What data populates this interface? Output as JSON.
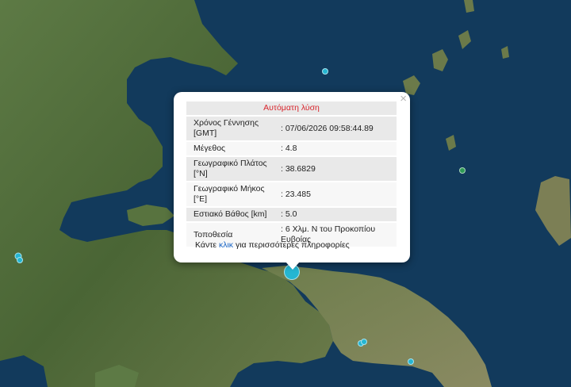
{
  "popup": {
    "title": "Αυτόματη λύση",
    "close": "×",
    "rows": [
      {
        "label": "Χρόνος Γέννησης [GMT]",
        "value": ": 07/06/2026 09:58:44.89"
      },
      {
        "label": "Μέγεθος",
        "value": ": 4.8"
      },
      {
        "label": "Γεωγραφικό Πλάτος [°N]",
        "value": ": 38.6829"
      },
      {
        "label": "Γεωγραφικό Μήκος [°E]",
        "value": ": 23.485"
      },
      {
        "label": "Εστιακό Βάθος [km]",
        "value": ": 5.0"
      },
      {
        "label": "Τοποθεσία",
        "value": ": 6 Χλμ. Ν του Προκοπίου Ευβοίας"
      }
    ],
    "more_prefix": "Κάντε",
    "more_link": "κλικ",
    "more_suffix": "για περισσότερες πληροφορίες"
  },
  "colors": {
    "sea": "#123a5c",
    "land": "#4e6b3a",
    "quake_cyan": "#25b6d2",
    "quake_green": "#2e9a55",
    "popup_title": "#d8252c",
    "link": "#1a66c7"
  },
  "quakes": [
    {
      "name": "quake-main",
      "color": "cyan",
      "magnitude_class": "large"
    },
    {
      "name": "quake-aegean-north",
      "color": "cyan"
    },
    {
      "name": "quake-aegean-east",
      "color": "green"
    },
    {
      "name": "quake-west-1",
      "color": "cyan"
    },
    {
      "name": "quake-west-2",
      "color": "cyan"
    },
    {
      "name": "quake-south-1",
      "color": "cyan"
    },
    {
      "name": "quake-south-2",
      "color": "cyan"
    },
    {
      "name": "quake-south-3",
      "color": "cyan"
    }
  ]
}
